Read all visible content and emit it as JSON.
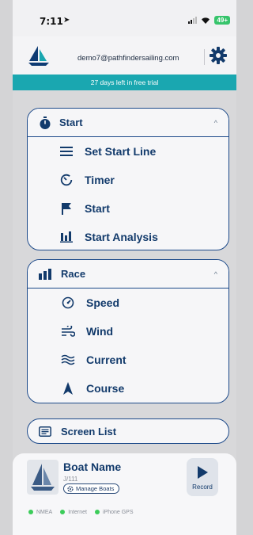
{
  "status_bar": {
    "time": "7:11",
    "battery": "49+"
  },
  "header": {
    "email": "demo7@pathfindersailing.com"
  },
  "trial_banner": "27 days left in free trial",
  "start_panel": {
    "title": "Start",
    "items": [
      {
        "label": "Set Start Line",
        "icon": "start-line-icon"
      },
      {
        "label": "Timer",
        "icon": "timer-icon"
      },
      {
        "label": "Start",
        "icon": "flag-icon"
      },
      {
        "label": "Start Analysis",
        "icon": "analysis-icon"
      }
    ]
  },
  "race_panel": {
    "title": "Race",
    "items": [
      {
        "label": "Speed",
        "icon": "speed-icon"
      },
      {
        "label": "Wind",
        "icon": "wind-icon"
      },
      {
        "label": "Current",
        "icon": "current-icon"
      },
      {
        "label": "Course",
        "icon": "course-icon"
      }
    ]
  },
  "screen_list": {
    "label": "Screen List"
  },
  "boat": {
    "name": "Boat Name",
    "class": "J/111",
    "manage_label": "Manage Boats",
    "record_label": "Record"
  },
  "connections": [
    {
      "label": "NMEA",
      "color": "#3ccc5a"
    },
    {
      "label": "Internet",
      "color": "#3ccc5a"
    },
    {
      "label": "iPhone GPS",
      "color": "#3ccc5a"
    }
  ]
}
